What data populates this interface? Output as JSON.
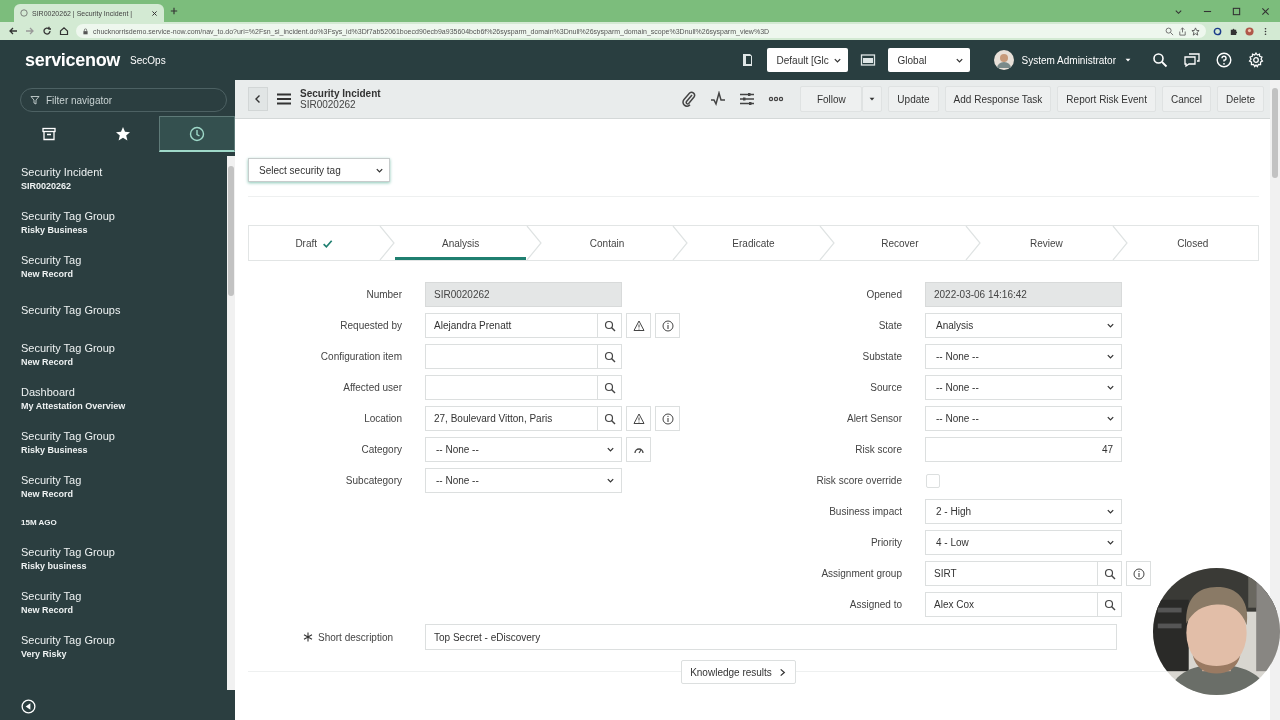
{
  "browser": {
    "tab_title": "SIR0020262 | Security Incident |",
    "url": "chucknorrisdemo.service-now.com/nav_to.do?uri=%2Fsn_si_incident.do%3Fsys_id%3Df7ab52061boecd90ecb9a935604bcb6f%26sysparm_domain%3Dnull%26sysparm_domain_scope%3Dnull%26sysparm_view%3D"
  },
  "header": {
    "brand": "servicenow",
    "app": "SecOps",
    "update_set": "Default [Glc",
    "scope": "Global",
    "user": "System Administrator"
  },
  "sidebar": {
    "filter_placeholder": "Filter navigator",
    "tabs": [
      {
        "kind": "archive",
        "selected": false
      },
      {
        "kind": "star",
        "selected": false
      },
      {
        "kind": "history",
        "selected": true
      }
    ],
    "items": [
      {
        "kind": "record",
        "title": "Security Incident",
        "subtitle": "SIR0020262"
      },
      {
        "kind": "record",
        "title": "Security Tag Group",
        "subtitle": "Risky Business"
      },
      {
        "kind": "record",
        "title": "Security Tag",
        "subtitle": "New Record"
      },
      {
        "kind": "record",
        "title": "Security Tag Groups"
      },
      {
        "kind": "record",
        "title": "Security Tag Group",
        "subtitle": "New Record"
      },
      {
        "kind": "record",
        "title": "Dashboard",
        "subtitle": "My Attestation Overview"
      },
      {
        "kind": "record",
        "title": "Security Tag Group",
        "subtitle": "Risky Business"
      },
      {
        "kind": "record",
        "title": "Security Tag",
        "subtitle": "New Record"
      },
      {
        "kind": "group",
        "title": "15M AGO"
      },
      {
        "kind": "record",
        "title": "Security Tag Group",
        "subtitle": "Risky business"
      },
      {
        "kind": "record",
        "title": "Security Tag",
        "subtitle": "New Record"
      },
      {
        "kind": "record",
        "title": "Security Tag Group",
        "subtitle": "Very Risky"
      }
    ]
  },
  "form": {
    "title": "Security Incident",
    "number": "SIR0020262",
    "actions": [
      {
        "label": "Follow",
        "kind": "split"
      },
      {
        "label": "Update",
        "kind": "plain"
      },
      {
        "label": "Add Response Task",
        "kind": "plain"
      },
      {
        "label": "Report Risk Event",
        "kind": "plain"
      },
      {
        "label": "Cancel",
        "kind": "plain"
      },
      {
        "label": "Delete",
        "kind": "plain"
      }
    ],
    "security_tag": {
      "placeholder": "Select security tag"
    },
    "stages": [
      {
        "label": "Draft",
        "done": true,
        "selected": false
      },
      {
        "label": "Analysis",
        "done": false,
        "selected": true
      },
      {
        "label": "Contain",
        "done": false,
        "selected": false
      },
      {
        "label": "Eradicate",
        "done": false,
        "selected": false
      },
      {
        "label": "Recover",
        "done": false,
        "selected": false
      },
      {
        "label": "Review",
        "done": false,
        "selected": false
      },
      {
        "label": "Closed",
        "done": false,
        "selected": false
      }
    ],
    "left_fields": [
      {
        "label": "Number",
        "value": "SIR0020262",
        "kind": "readonly"
      },
      {
        "label": "Requested by",
        "value": "Alejandra Prenatt",
        "kind": "reference-alert"
      },
      {
        "label": "Configuration item",
        "kind": "reference"
      },
      {
        "label": "Affected user",
        "kind": "reference"
      },
      {
        "label": "Location",
        "value": "27, Boulevard Vitton, Paris",
        "kind": "reference-alert"
      },
      {
        "label": "Category",
        "value": "-- None --",
        "kind": "select-gauge"
      },
      {
        "label": "Subcategory",
        "value": "-- None --",
        "kind": "select"
      }
    ],
    "right_fields": [
      {
        "label": "Opened",
        "value": "2022-03-06 14:16:42",
        "kind": "readonly"
      },
      {
        "label": "State",
        "value": "Analysis",
        "kind": "select"
      },
      {
        "label": "Substate",
        "value": "-- None --",
        "kind": "select"
      },
      {
        "label": "Source",
        "value": "-- None --",
        "kind": "select"
      },
      {
        "label": "Alert Sensor",
        "value": "-- None --",
        "kind": "select"
      },
      {
        "label": "Risk score",
        "value": "47",
        "kind": "number"
      },
      {
        "label": "Risk score override",
        "kind": "checkbox",
        "checked": false
      },
      {
        "label": "Business impact",
        "value": "2 - High",
        "kind": "select"
      },
      {
        "label": "Priority",
        "value": "4 - Low",
        "kind": "select"
      },
      {
        "label": "Assignment group",
        "value": "SIRT",
        "kind": "reference-info"
      },
      {
        "label": "Assigned to",
        "value": "Alex Cox",
        "kind": "reference"
      }
    ],
    "short_description": {
      "label": "Short description",
      "value": "Top Secret - eDiscovery",
      "required": true
    },
    "knowledge_button": "Knowledge results"
  }
}
